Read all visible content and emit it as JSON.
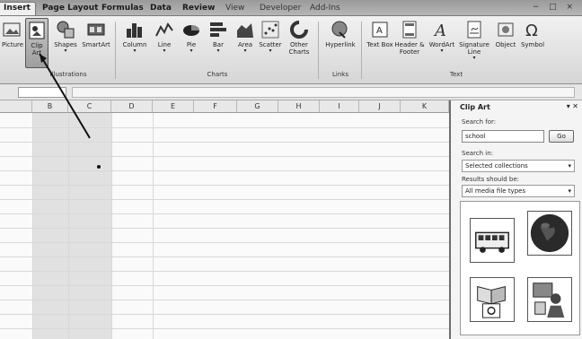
{
  "tabs": [
    "Insert",
    "Page Layout",
    "Formulas",
    "Data",
    "Review",
    "View",
    "Developer",
    "Add-Ins"
  ],
  "window_controls": "− □ ×",
  "ribbon": {
    "buttons": {
      "picture": "Picture",
      "clip_art": "Clip Art",
      "shapes": "Shapes",
      "smartart": "SmartArt",
      "column": "Column",
      "line": "Line",
      "pie": "Pie",
      "bar": "Bar",
      "area": "Area",
      "scatter": "Scatter",
      "other_charts": "Other Charts",
      "hyperlink": "Hyperlink",
      "text_box": "Text Box",
      "header_footer": "Header & Footer",
      "wordart": "WordArt",
      "signature_line": "Signature Line",
      "object": "Object",
      "symbol": "Symbol"
    },
    "groups": {
      "illustrations": "Illustrations",
      "charts": "Charts",
      "links": "Links",
      "text": "Text"
    }
  },
  "sheet": {
    "columns": [
      "B",
      "C",
      "D",
      "E",
      "F",
      "G",
      "H",
      "I",
      "J",
      "K"
    ]
  },
  "task_pane": {
    "title": "Clip Art",
    "search_for_label": "Search for:",
    "search_value": "school",
    "go_label": "Go",
    "search_in_label": "Search in:",
    "search_in_value": "Selected collections",
    "results_label": "Results should be:",
    "results_value": "All media file types",
    "clips": [
      "school-bus-icon",
      "globe-icon",
      "book-icon",
      "teacher-icon"
    ]
  }
}
